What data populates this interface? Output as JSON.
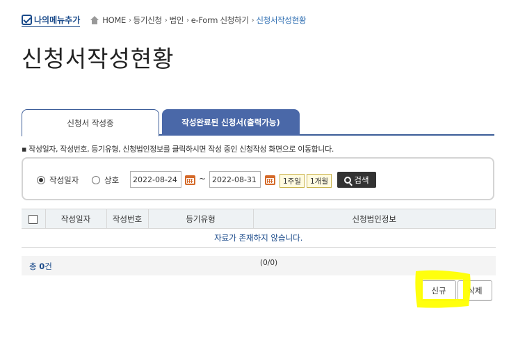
{
  "header": {
    "my_menu_label": "나의메뉴추가",
    "breadcrumb": [
      "HOME",
      "등기신청",
      "법인",
      "e-Form 신청하기"
    ],
    "breadcrumb_current": "신청서작성현황"
  },
  "page_title": "신청서작성현황",
  "tabs": [
    {
      "label": "신청서 작성중",
      "active": true
    },
    {
      "label": "작성완료된 신청서(출력가능)",
      "active": false
    }
  ],
  "notice": "▪ 작성일자, 작성번호, 등기유형, 신청법인정보를 클릭하시면 작성 중인 신청작성 화면으로 이동합니다.",
  "search": {
    "radio_date_label": "작성일자",
    "radio_name_label": "상호",
    "selected": "date",
    "date_from": "2022-08-24",
    "date_to": "2022-08-31",
    "tilde": "~",
    "week_button": "1주일",
    "month_button": "1개월",
    "search_button": "검색"
  },
  "table": {
    "columns": [
      "작성일자",
      "작성번호",
      "등기유형",
      "신청법인정보"
    ],
    "empty_message": "자료가 존재하지 않습니다."
  },
  "summary": {
    "total_prefix": "총",
    "total_count": "0",
    "total_suffix": "건",
    "paging": "(0/0)"
  },
  "actions": {
    "new_button": "신규",
    "delete_button": "삭제"
  },
  "colors": {
    "tab_inactive_bg": "#4a68a8",
    "accent": "#1a4a8a",
    "highlight": "#ffff00"
  }
}
